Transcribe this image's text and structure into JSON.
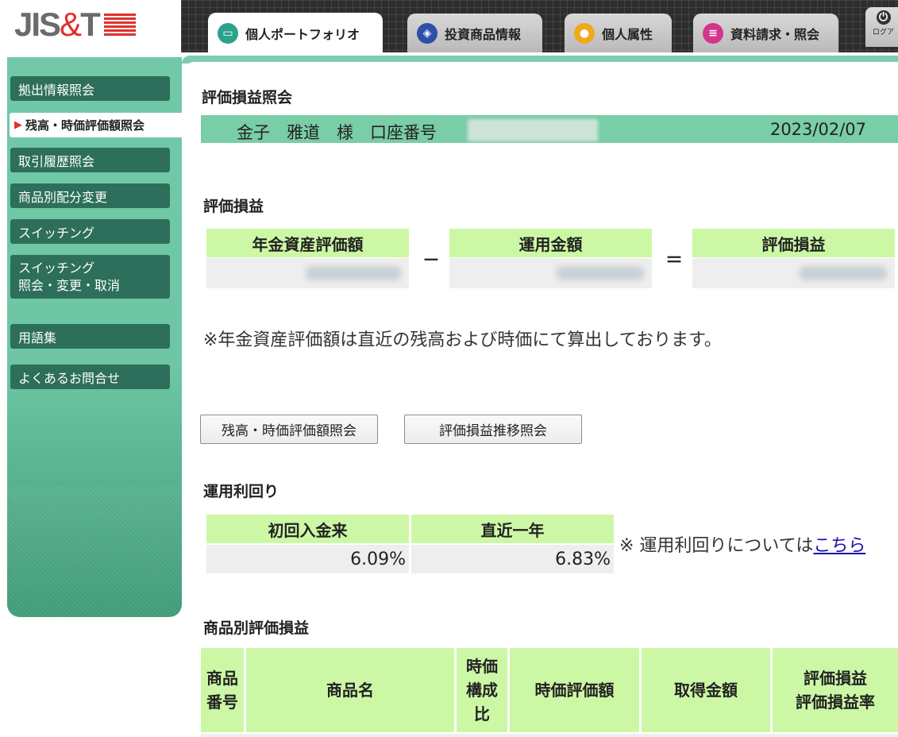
{
  "header": {
    "logo_text_a": "JIS",
    "logo_text_b": "&",
    "logo_text_c": "T",
    "tabs": [
      {
        "label": "個人ポートフォリオ",
        "icon": "folder-icon",
        "color": "#2aa38a",
        "active": true
      },
      {
        "label": "投資商品情報",
        "icon": "cube-icon",
        "color": "#2d4fa8",
        "active": false
      },
      {
        "label": "個人属性",
        "icon": "user-icon",
        "color": "#f2a81d",
        "active": false
      },
      {
        "label": "資料請求・照会",
        "icon": "document-icon",
        "color": "#d6338c",
        "active": false
      }
    ],
    "logout_label": "ログア"
  },
  "sidebar": {
    "items": [
      {
        "label": "拠出情報照会"
      },
      {
        "label": "残高・時価評価額照会",
        "active": true
      },
      {
        "label": "取引履歴照会"
      },
      {
        "label": "商品別配分変更"
      },
      {
        "label": "スイッチング"
      },
      {
        "label_line1": "スイッチング",
        "label_line2": "照会・変更・取消"
      },
      {
        "label": "用語集"
      },
      {
        "label": "よくあるお問合せ"
      }
    ]
  },
  "main": {
    "page_title": "評価損益照会",
    "account": {
      "name": "金子　雅道　様　口座番号",
      "date": "2023/02/07"
    },
    "valuation": {
      "section_title": "評価損益",
      "col1": "年金資産評価額",
      "col2": "運用金額",
      "col3": "評価損益",
      "minus": "－",
      "equals": "＝"
    },
    "note": "※年金資産評価額は直近の残高および時価にて算出しております。",
    "buttons": {
      "balance": "残高・時価評価額照会",
      "trend": "評価損益推移照会"
    },
    "yield": {
      "section_title": "運用利回り",
      "col1": "初回入金来",
      "col2": "直近一年",
      "val1": "6.09%",
      "val2": "6.83%",
      "note_prefix": "※ 運用利回りについては",
      "note_link": "こちら"
    },
    "products": {
      "section_title": "商品別評価損益",
      "h_no_1": "商品",
      "h_no_2": "番号",
      "h_name": "商品名",
      "h_ratio_1": "時価",
      "h_ratio_2": "構成",
      "h_ratio_3": "比",
      "h_market": "時価評価額",
      "h_cost": "取得金額",
      "h_pl_1": "評価損益",
      "h_pl_2": "評価損益率"
    }
  }
}
